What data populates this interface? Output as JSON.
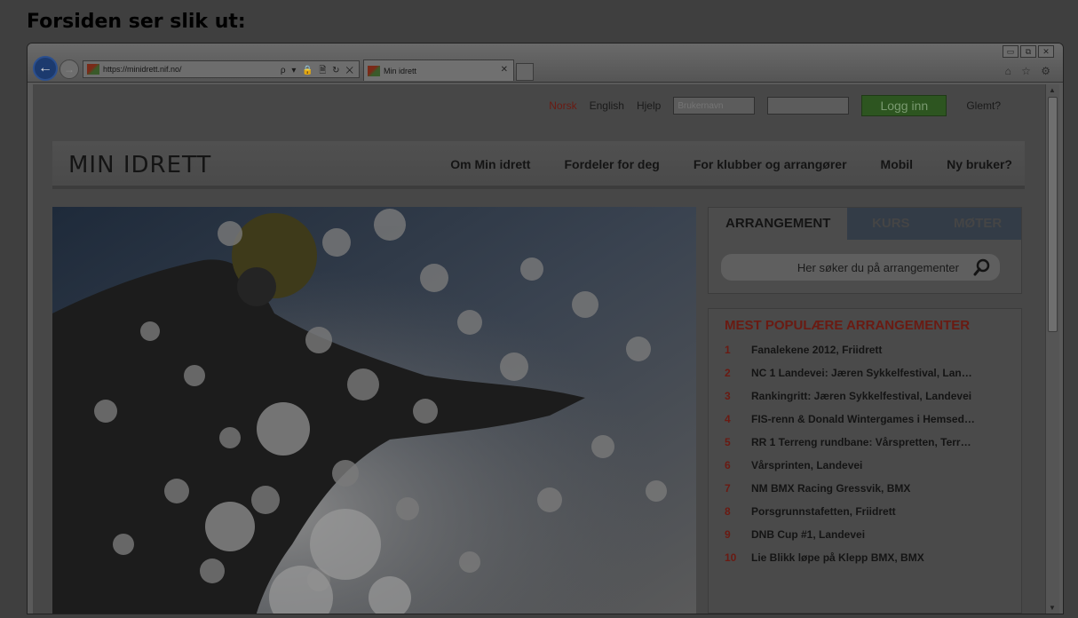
{
  "caption": "Forsiden ser slik ut:",
  "browser": {
    "url": "https://minidrett.nif.no/",
    "tab_title": "Min idrett",
    "address_tools": "ρ ▾ 🔒 🗎 ↻ ✕",
    "tab_close": "✕",
    "back_icon": "←",
    "forward_icon": "→",
    "window_controls": [
      "▭",
      "⧉",
      "✕"
    ],
    "tool_icons": "⌂ ☆ ⚙"
  },
  "topbar": {
    "lang_norsk": "Norsk",
    "lang_english": "English",
    "help": "Hjelp",
    "username_placeholder": "Brukernavn",
    "login": "Logg inn",
    "forgot": "Glemt?"
  },
  "nav": {
    "logo": "MIN IDRETT",
    "items": [
      "Om Min idrett",
      "Fordeler for deg",
      "For klubber og arrangører",
      "Mobil",
      "Ny bruker?"
    ]
  },
  "search": {
    "tabs": [
      "ARRANGEMENT",
      "KURS",
      "MØTER"
    ],
    "placeholder": "Her søker du på arrangementer"
  },
  "popular": {
    "title": "MEST POPULÆRE ARRANGEMENTER",
    "items": [
      {
        "n": "1",
        "name": "Fanalekene 2012, Friidrett"
      },
      {
        "n": "2",
        "name": "NC 1 Landevei: Jæren Sykkelfestival, Lan…"
      },
      {
        "n": "3",
        "name": "Rankingritt: Jæren Sykkelfestival, Landevei"
      },
      {
        "n": "4",
        "name": "FIS-renn & Donald Wintergames i Hemsed…"
      },
      {
        "n": "5",
        "name": "RR 1 Terreng rundbane: Vårspretten, Terr…"
      },
      {
        "n": "6",
        "name": "Vårsprinten, Landevei"
      },
      {
        "n": "7",
        "name": "NM BMX Racing Gressvik, BMX"
      },
      {
        "n": "8",
        "name": "Porsgrunnstafetten, Friidrett"
      },
      {
        "n": "9",
        "name": "DNB Cup #1, Landevei"
      },
      {
        "n": "10",
        "name": "Lie Blikk løpe på Klepp BMX, BMX"
      }
    ]
  },
  "colors": {
    "accent_red": "#6a1a12",
    "login_green": "#2d5520",
    "tab_inactive": "#333c47"
  }
}
